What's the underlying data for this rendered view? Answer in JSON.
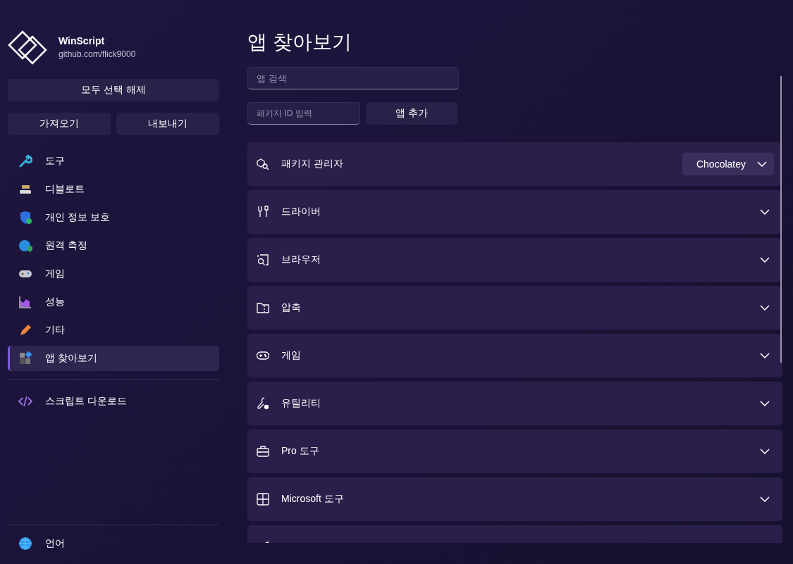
{
  "app": {
    "name": "WinScript",
    "subtitle": "github.com/flick9000"
  },
  "sidebar": {
    "deselect_button": "모두 선택 해제",
    "import_button": "가져오기",
    "export_button": "내보내기",
    "items": [
      {
        "label": "도구",
        "kind": "wrench",
        "selected": false
      },
      {
        "label": "디블로트",
        "kind": "drive",
        "selected": false
      },
      {
        "label": "개인 정보 보호",
        "kind": "shield",
        "selected": false
      },
      {
        "label": "원격 측정",
        "kind": "globe-shield",
        "selected": false
      },
      {
        "label": "게임",
        "kind": "gamepad",
        "selected": false
      },
      {
        "label": "성능",
        "kind": "chart",
        "selected": false
      },
      {
        "label": "기타",
        "kind": "pencil",
        "selected": false
      },
      {
        "label": "앱 찾아보기",
        "kind": "apps",
        "selected": true
      }
    ],
    "download_item": {
      "label": "스크립트 다운로드"
    },
    "language_item": {
      "label": "언어"
    }
  },
  "main": {
    "title": "앱 찾아보기",
    "search": {
      "placeholder": "앱 검색"
    },
    "package_id": {
      "placeholder": "패키지 ID 입력"
    },
    "add_button": "앱 추가",
    "categories": [
      {
        "label": "패키지 관리자",
        "kind": "package",
        "dropdown": "Chocolatey"
      },
      {
        "label": "드라이버",
        "kind": "tools"
      },
      {
        "label": "브라우저",
        "kind": "browser"
      },
      {
        "label": "압축",
        "kind": "zip"
      },
      {
        "label": "게임",
        "kind": "gamepad"
      },
      {
        "label": "유틸리티",
        "kind": "wrench-gear"
      },
      {
        "label": "Pro 도구",
        "kind": "toolbox"
      },
      {
        "label": "Microsoft 도구",
        "kind": "windows"
      },
      {
        "kind": "partial"
      }
    ]
  }
}
